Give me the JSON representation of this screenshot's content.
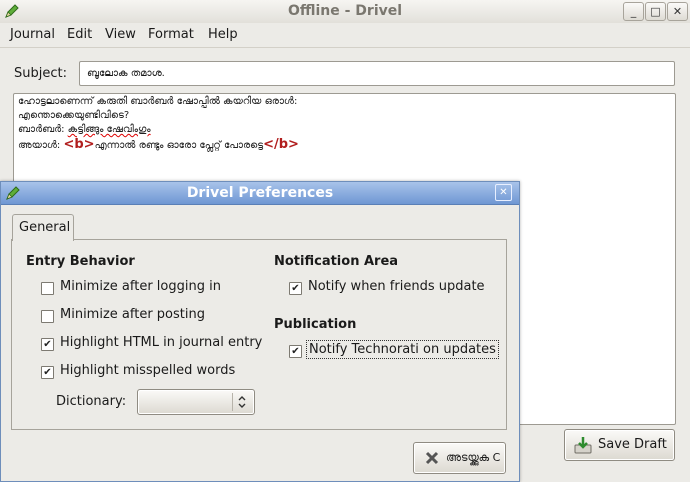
{
  "window": {
    "title": "Offline - Drivel",
    "minimize": "_",
    "maximize": "□",
    "close": "✕"
  },
  "menu": {
    "journal": "Journal",
    "edit": "Edit",
    "view": "View",
    "format": "Format",
    "help": "Help"
  },
  "subject": {
    "label": "Subject:",
    "value": "ബൂലോക തമാശ."
  },
  "editor": {
    "line1": "ഹോട്ടലാണെന്ന് കരുതി ബാർബർ ഷോപ്പിൽ കയറിയ ഒരാൾ:",
    "line2": "എന്തൊക്കെയുണ്ടിവിടെ?",
    "line3_prefix": "ബാർബർ: ",
    "line3_word": "കട്ടിങ്ങും ഷേവിംഗും",
    "line4_prefix": "അയാൾ: ",
    "tag_open": "<b>",
    "line4_text": "എന്നാൽ രണ്ടും ഓരോ പ്ലേറ്റ് പോരട്ടെ",
    "tag_close": "</b>"
  },
  "save_draft": "Save Draft",
  "dialog": {
    "title": "Drivel Preferences",
    "close": "✕",
    "tab_general": "General",
    "entry_behavior": "Entry Behavior",
    "opt_min_login": "Minimize after logging in",
    "opt_min_post": "Minimize after posting",
    "opt_highlight_html": "Highlight HTML in journal entry",
    "opt_highlight_misspelled": "Highlight misspelled words",
    "dictionary_label": "Dictionary:",
    "dictionary_value": "",
    "notification_area": "Notification Area",
    "opt_notify_friends": "Notify when friends update",
    "publication": "Publication",
    "opt_notify_technorati": "Notify Technorati on updates",
    "close_button": "അടയ്ക്കുക C"
  },
  "checkboxes": {
    "min_login": false,
    "min_post": false,
    "highlight_html": true,
    "highlight_misspelled": true,
    "notify_friends": true,
    "notify_technorati": true
  },
  "icons": {
    "app": "drivel-pencil-icon",
    "save": "save-draft-icon",
    "close_x": "close-x-icon",
    "spinner": "combo-arrows-icon"
  }
}
